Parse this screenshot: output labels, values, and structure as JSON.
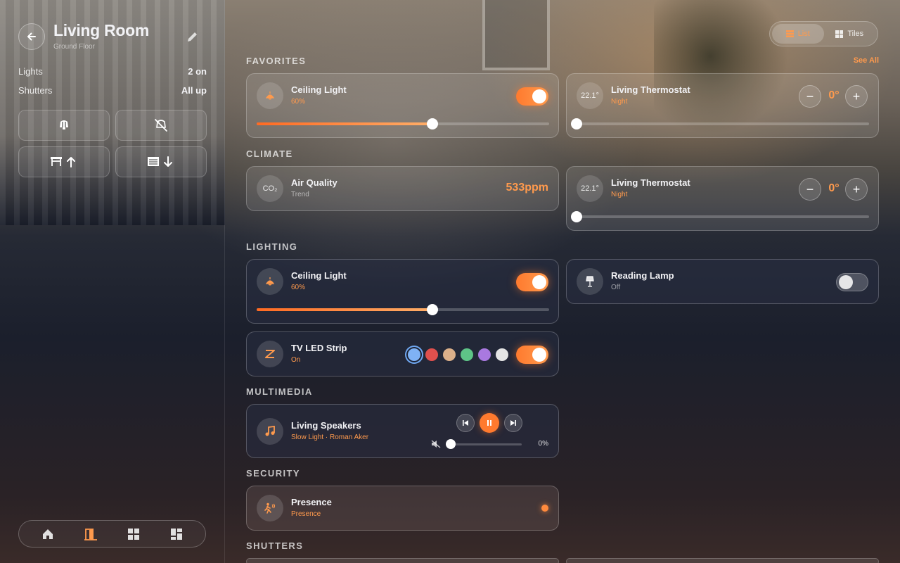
{
  "room": {
    "title": "Living Room",
    "subtitle": "Ground Floor"
  },
  "summary": [
    {
      "label": "Lights",
      "value": "2 on"
    },
    {
      "label": "Shutters",
      "value": "All up"
    }
  ],
  "quick_actions": [
    "lights-on-icon",
    "lights-off-icon",
    "shutters-up-icon",
    "shutters-down-icon"
  ],
  "view_toggle": {
    "list": "List",
    "tiles": "Tiles",
    "active": "List"
  },
  "sections": {
    "favorites": "FAVORITES",
    "climate": "CLIMATE",
    "lighting": "LIGHTING",
    "multimedia": "MULTIMEDIA",
    "security": "SECURITY",
    "shutters": "SHUTTERS"
  },
  "see_all": "See All",
  "favorites": {
    "ceiling_light": {
      "title": "Ceiling Light",
      "status": "60%",
      "on": true,
      "level": 0.6
    },
    "thermostat": {
      "badge": "22.1°",
      "title": "Living Thermostat",
      "mode": "Night",
      "setpoint": "0°",
      "minus": "−",
      "plus": "+",
      "level": 0.0
    }
  },
  "climate": {
    "air_quality": {
      "badge": "CO₂",
      "title": "Air Quality",
      "subtitle": "Trend",
      "value": "533ppm"
    },
    "thermostat": {
      "badge": "22.1°",
      "title": "Living Thermostat",
      "mode": "Night",
      "setpoint": "0°",
      "minus": "−",
      "plus": "+",
      "level": 0.0
    }
  },
  "lighting": {
    "ceiling_light": {
      "title": "Ceiling Light",
      "status": "60%",
      "on": true,
      "level": 0.6
    },
    "reading_lamp": {
      "title": "Reading Lamp",
      "status": "Off",
      "on": false
    },
    "tv_led": {
      "title": "TV LED Strip",
      "status": "On",
      "on": true,
      "colors": [
        "#7fb2f5",
        "#e0504d",
        "#dcb08a",
        "#5ec487",
        "#a979e0",
        "#e4e4e4"
      ],
      "selected_color": 0
    }
  },
  "multimedia": {
    "speakers": {
      "title": "Living Speakers",
      "track": "Slow Light · Roman Aker",
      "volume": "0%",
      "volume_level": 0.0
    }
  },
  "security": {
    "presence": {
      "title": "Presence",
      "status": "Presence",
      "active": true
    }
  },
  "colors": {
    "accent": "#ff9a4d",
    "accent_strong": "#ff7a2e"
  },
  "bottom_nav": [
    "home-icon",
    "room-icon",
    "grid-icon",
    "dashboard-icon"
  ]
}
